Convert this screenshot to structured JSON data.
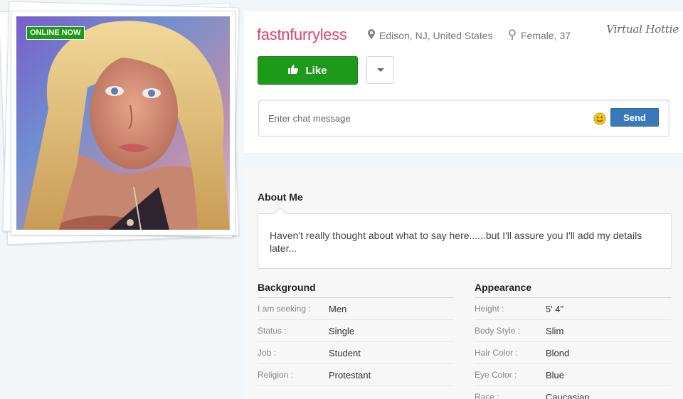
{
  "profile": {
    "online_badge": "ONLINE NOW",
    "username": "fastnfurryless",
    "location": "Edison, NJ, United States",
    "gender_age": "Female, 37",
    "brand_logo": "Virtual Hottie"
  },
  "actions": {
    "like_label": "Like"
  },
  "chat": {
    "placeholder": "Enter chat message",
    "send_label": "Send"
  },
  "about": {
    "title": "About Me",
    "text": "Haven't really thought about what to say here......but I'll assure you I'll add my details later..."
  },
  "background": {
    "title": "Background",
    "rows": [
      {
        "key": "I am seeking :",
        "value": "Men"
      },
      {
        "key": "Status :",
        "value": "Single"
      },
      {
        "key": "Job :",
        "value": "Student"
      },
      {
        "key": "Religion :",
        "value": "Protestant"
      }
    ]
  },
  "appearance": {
    "title": "Appearance",
    "rows": [
      {
        "key": "Height :",
        "value": "5' 4\""
      },
      {
        "key": "Body Style :",
        "value": "Slim"
      },
      {
        "key": "Hair Color :",
        "value": "Blond"
      },
      {
        "key": "Eye Color :",
        "value": "Blue"
      },
      {
        "key": "Race :",
        "value": "Caucasian"
      }
    ]
  },
  "colors": {
    "username": "#e0436b",
    "like_button": "#1e9a1b",
    "send_button": "#3a79b9",
    "online_badge": "#1f9a17"
  },
  "icons": [
    "map-pin-icon",
    "gender-icon",
    "thumbs-up-icon",
    "chevron-down-icon",
    "smiley-icon"
  ]
}
